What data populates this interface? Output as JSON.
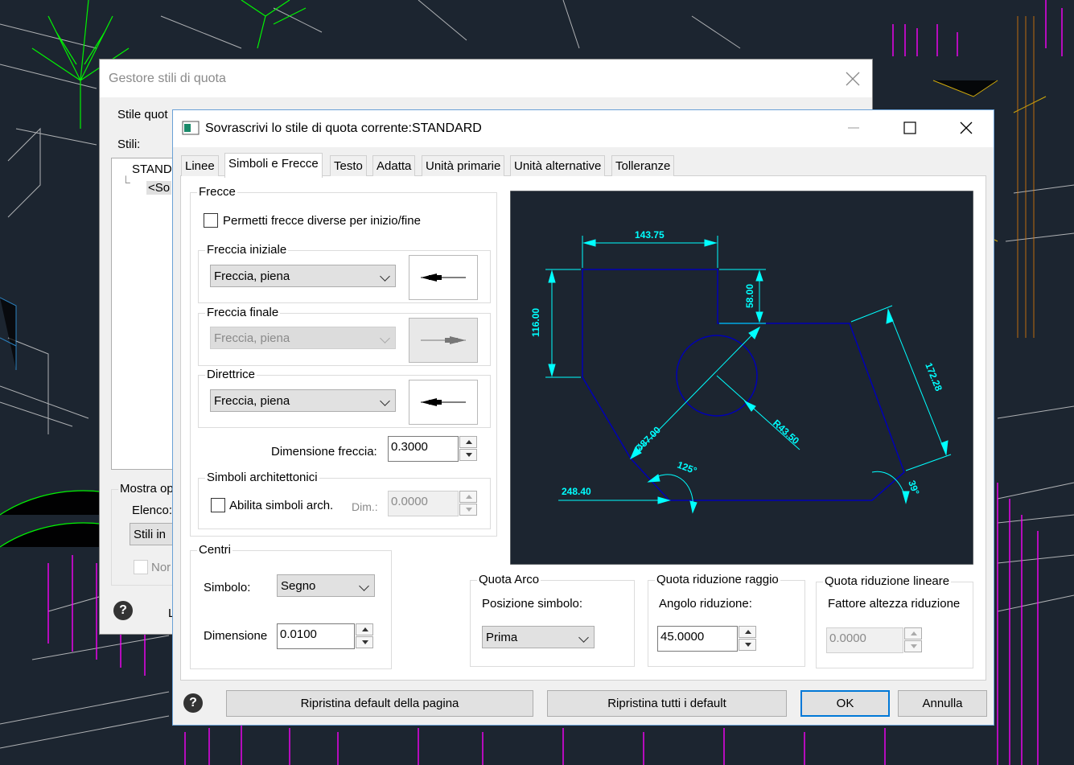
{
  "background": {
    "color": "#1c2530"
  },
  "parent_dialog": {
    "title": "Gestore stili di quota",
    "current_style_label": "Stile quot",
    "styles_label": "Stili:",
    "tree": [
      "STAND",
      "<So"
    ],
    "show_label": "Mostra op",
    "list_label": "Elenco:",
    "list_value": "Stili in",
    "checkbox_label": "Nor",
    "footer_text": "L"
  },
  "dialog": {
    "title": "Sovrascrivi lo stile di quota corrente:STANDARD",
    "tabs": [
      {
        "label": "Linee",
        "active": false
      },
      {
        "label": "Simboli e Frecce",
        "active": true
      },
      {
        "label": "Testo",
        "active": false
      },
      {
        "label": "Adatta",
        "active": false
      },
      {
        "label": "Unità primarie",
        "active": false
      },
      {
        "label": "Unità alternative",
        "active": false
      },
      {
        "label": "Tolleranze",
        "active": false
      }
    ],
    "arrows": {
      "group_label": "Frecce",
      "allow_different_label": "Permetti frecce diverse per inizio/fine",
      "first_label": "Freccia iniziale",
      "first_value": "Freccia, piena",
      "second_label": "Freccia finale",
      "second_value": "Freccia, piena",
      "leader_label": "Direttrice",
      "leader_value": "Freccia, piena",
      "size_label": "Dimensione freccia:",
      "size_value": "0.3000"
    },
    "arch_symbols": {
      "group_label": "Simboli architettonici",
      "enable_label": "Abilita simboli arch.",
      "dim_label": "Dim.:",
      "dim_value": "0.0000"
    },
    "centers": {
      "group_label": "Centri",
      "symbol_label": "Simbolo:",
      "symbol_value": "Segno",
      "size_label": "Dimensione",
      "size_value": "0.0100"
    },
    "arc_dim": {
      "group_label": "Quota Arco",
      "position_label": "Posizione simbolo:",
      "position_value": "Prima"
    },
    "radius_jog": {
      "group_label": "Quota riduzione raggio",
      "angle_label": "Angolo riduzione:",
      "angle_value": "45.0000"
    },
    "linear_jog": {
      "group_label": "Quota riduzione lineare",
      "factor_label": "Fattore altezza riduzione",
      "factor_value": "0.0000"
    },
    "preview": {
      "dims": {
        "top": "143.75",
        "left": "116.00",
        "step": "58.00",
        "slant": "172.28",
        "diameter": "Ø87.00",
        "radius": "R43.50",
        "bottom": "248.40",
        "angle1": "125°",
        "angle2": "39°"
      },
      "colors": {
        "bg": "#1c2530",
        "dim": "#00ffff",
        "geom": "#0000b4"
      }
    },
    "buttons": {
      "reset_page": "Ripristina default della pagina",
      "reset_all": "Ripristina tutti i default",
      "ok": "OK",
      "cancel": "Annulla"
    }
  }
}
